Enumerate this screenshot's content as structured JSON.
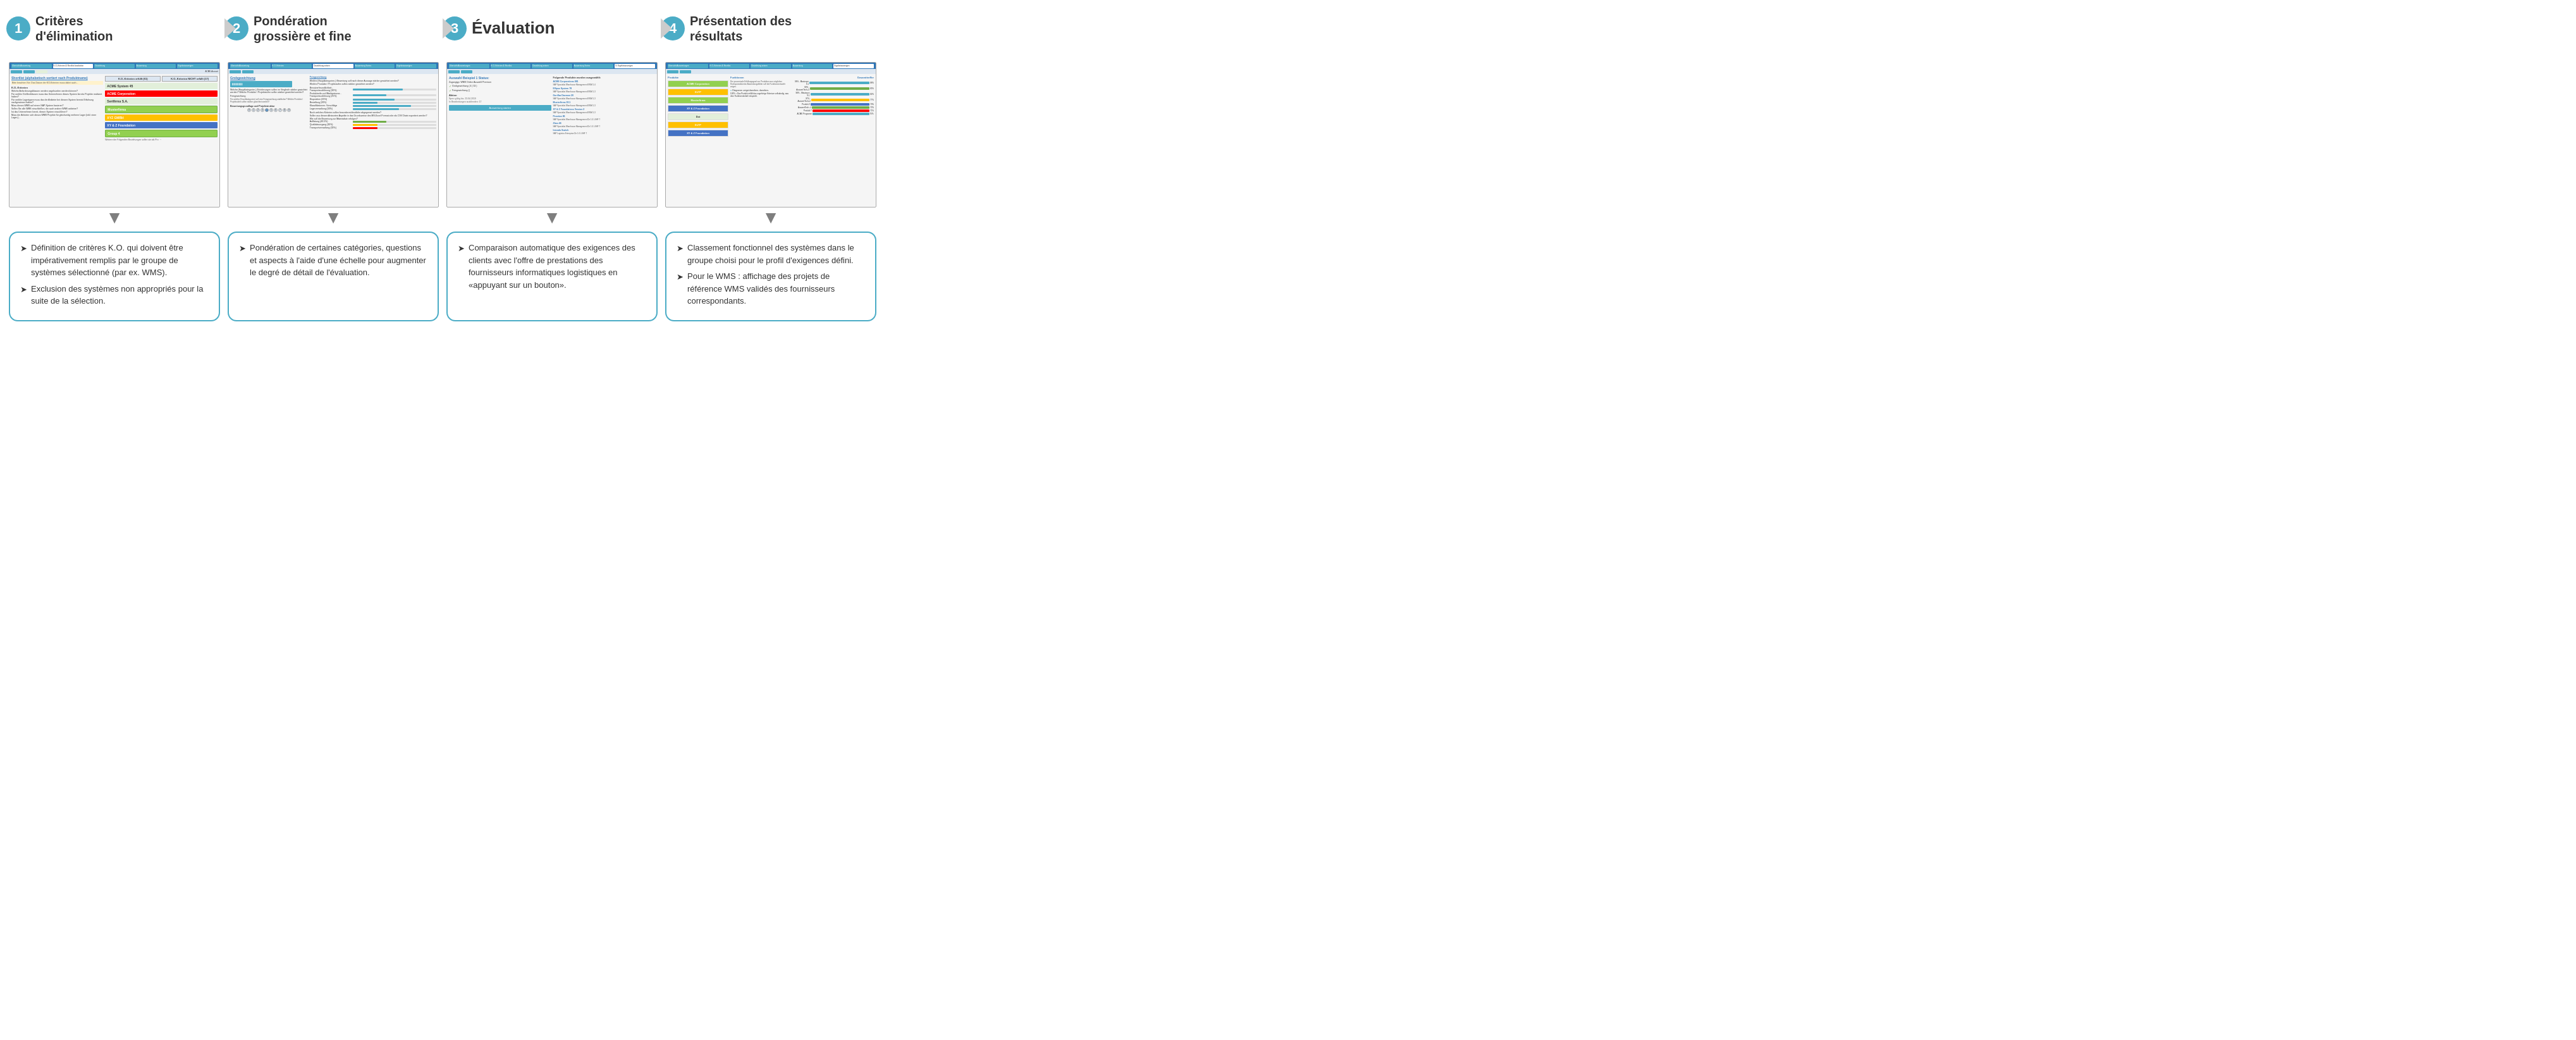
{
  "banner": {
    "steps": [
      {
        "number": "1",
        "title_line1": "Critères",
        "title_line2": "d'élimination"
      },
      {
        "number": "2",
        "title_line1": "Pondération",
        "title_line2": "grossière et fine"
      },
      {
        "number": "3",
        "title_line1": "Évaluation",
        "title_line2": ""
      },
      {
        "number": "4",
        "title_line1": "Présentation des",
        "title_line2": "résultats"
      }
    ]
  },
  "screens": [
    {
      "id": "screen1",
      "nav_tabs": [
        "Übersicht Auswertung",
        "K.O.-Kriterien & Shortlist bearbeiten",
        "Gewichtung setzen",
        "Auswertung setzen",
        "Ergebnisanzeigen"
      ],
      "active_tab": 1,
      "sorted_label": "Shortlist (alphabetisch sortiert nach Produktname)",
      "ko_header_yes": "K.O.-Kriterien erfüllt (61)",
      "ko_header_no": "K.O.-Kriterien NICHT erfüllt (17)",
      "companies": [
        {
          "name": "ACME System 45",
          "style": "light"
        },
        {
          "name": "ACME Corporation",
          "style": "red"
        },
        {
          "name": "Sertfirma S.A.",
          "style": "light"
        },
        {
          "name": "Musterfirma",
          "style": "green"
        },
        {
          "name": "XYZ GMBH",
          "style": "orange"
        },
        {
          "name": "XY & Z Foundation",
          "style": "blue"
        },
        {
          "name": "Group 4",
          "style": "green"
        }
      ]
    },
    {
      "id": "screen2",
      "nav_tabs": [
        "Übersicht Auswertung",
        "K.O.-Kriterien & Shortlist bearbeiten",
        "Gewichtung setzen",
        "Auswertung Sortex",
        "Ergebnisanzeigen"
      ],
      "active_tab": 2,
      "section_gross": "Grobgewichtung",
      "section_fine": "Feingewichtung",
      "gross_items": [
        {
          "label": "Benutzerfreundlichkeit",
          "pct": 60
        },
        {
          "label": "Produktreife und Marktpräsenz",
          "pct": 40
        },
        {
          "label": "Kosteneffizienz",
          "pct": 55
        },
        {
          "label": "Klassifikationen: Vorschläge",
          "pct": 70
        }
      ],
      "fine_items": [
        {
          "label": "Lagerverwaltung (30%)",
          "pct": 30
        },
        {
          "label": "Transport (25%)",
          "pct": 25
        },
        {
          "label": "Disposition (25%)",
          "pct": 25
        },
        {
          "label": "Bestellung (20%)",
          "pct": 20
        }
      ],
      "number_scale": [
        "0",
        "1",
        "2",
        "3",
        "4",
        "5",
        "6",
        "7",
        "8",
        "9"
      ],
      "active_number": 5
    },
    {
      "id": "screen3",
      "nav_tabs": [
        "Übersicht Auswertungen",
        "K.O.-Kriterien & Shortlist bearbeiten",
        "Gewichtung setzen",
        "Auswertung Sortex",
        "9. Ergebnisanzeigen"
      ],
      "active_tab": 4,
      "auswahl_title": "Auswahl Beispiel 1 Status:",
      "zugang_label": "Zugangstyp: WMS Online Auswahl Premium",
      "checks": [
        "Grobgewichtung (4 | 53 )",
        "Feingewichtung ()"
      ],
      "action_title": "Aktion",
      "valid_until": "Sperr gültig bis: 23.04.2019",
      "in_bearbeitung": "In Bearbeitungen ausblenden: 17",
      "button_label": "Auswertung starten",
      "products_title": "Folgende Produkte wurden ausgewählt:",
      "products": [
        {
          "name": "ACME Corporations 881",
          "sub": "SAP Specialist Warehouse Management EWM 1.4"
        },
        {
          "name": "Ellipse System 78",
          "sub": "SAP Specialist Warehouse Management EWM 1.3"
        },
        {
          "name": "Gorillaz Daemon 20",
          "sub": "SAP Specialist Warehouse Management EWM 1.3"
        },
        {
          "name": "Musterfirma 30.1",
          "sub": "SAP Specialist Warehouse Management EWM 1.3"
        },
        {
          "name": "XY & Z Foundations Version 2",
          "sub": "SAP Specialist Warehouse Management EWM 1.3"
        },
        {
          "name": "Penetize 86",
          "sub": "SAP Specialist Warehouse Management Dir 1.0 LSHF 7"
        },
        {
          "name": "Zbos 46",
          "sub": "SAP Specialist Warehouse Management Dir 1.0 LSHF 7"
        },
        {
          "name": "Intendo Switch",
          "sub": "SAP Logistics Enterprise Dir 1.0 LSHF 7"
        }
      ]
    },
    {
      "id": "screen4",
      "nav_tabs": [
        "Übersicht Auswertungen",
        "K.O.-Kriterien & Shortlist bearbeiten",
        "Gewichtung setzen",
        "Auswertung Sortex",
        "Ergebnisanzeigen"
      ],
      "active_tab": 4,
      "products_title": "Produkte",
      "total_title": "Gesamttreffer",
      "logos": [
        {
          "name": "ACME Corporation",
          "style": "green"
        },
        {
          "name": "ELTP",
          "style": "yellow"
        },
        {
          "name": "Musterfirma",
          "style": "green"
        },
        {
          "name": "XY & Z Foundation",
          "style": "blue"
        },
        {
          "name": "Dot",
          "style": "light-green"
        },
        {
          "name": "ELTP",
          "style": "yellow"
        },
        {
          "name": "XY & Z Foundation",
          "style": "blue"
        }
      ],
      "bars": [
        {
          "label": "Top Produkt 1",
          "pct": 88,
          "pct_label": "88%"
        },
        {
          "label": "AuswertTech +3",
          "pct": 85,
          "pct_label": "85%"
        },
        {
          "label": "Masterpro S.1",
          "pct": 82,
          "pct_label": "82%"
        },
        {
          "label": "AuswertTech +2",
          "pct": 77,
          "pct_label": "77%"
        },
        {
          "label": "Produkt X",
          "pct": 79,
          "pct_label": "79%"
        },
        {
          "label": "AuswertTech +2",
          "pct": 72,
          "pct_label": "72%"
        },
        {
          "label": "Produkt Y",
          "pct": 71,
          "pct_label": "71%"
        },
        {
          "label": "ACME Programm",
          "pct": 70,
          "pct_label": "70%"
        }
      ]
    }
  ],
  "descriptions": [
    {
      "bullets": [
        "Définition de critères K.O. qui doivent être impérativement remplis par le groupe de systèmes sélectionné (par ex. WMS).",
        "Exclusion des systèmes non appropriés pour la suite de la sélection."
      ]
    },
    {
      "bullets": [
        "Pondération de certaines catégories, questions et aspects à l'aide d'une échelle pour augmenter le degré de détail de l'évaluation."
      ]
    },
    {
      "bullets": [
        "Comparaison automatique des exigences des clients avec l'offre de prestations des fournisseurs informatiques logistiques en «appuyant sur un bouton»."
      ]
    },
    {
      "bullets": [
        "Classement fonctionnel des systèmes dans le groupe choisi pour le profil d'exigences défini.",
        "Pour le WMS : affichage des projets de référence WMS validés des fournisseurs correspondants."
      ]
    }
  ]
}
